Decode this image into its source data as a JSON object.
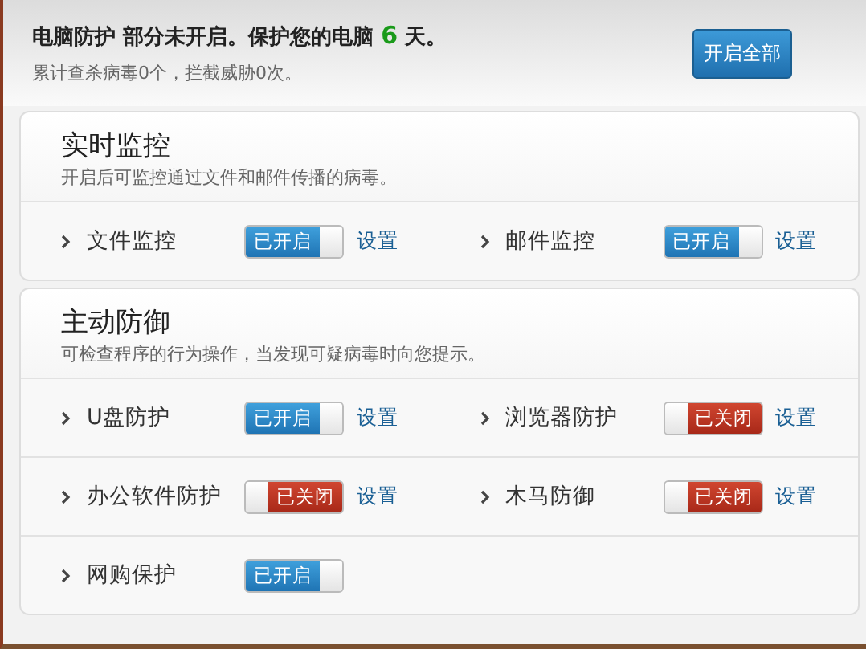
{
  "header": {
    "status_before": "电脑防护 部分未开启。保护您的电脑",
    "days": "6",
    "status_after": "天。",
    "stats": "累计查杀病毒0个，拦截威胁0次。",
    "button": "开启全部"
  },
  "sections": [
    {
      "title": "实时监控",
      "description": "开启后可监控通过文件和邮件传播的病毒。",
      "rows": [
        [
          {
            "label": "文件监控",
            "on": true,
            "toggle_text": "已开启",
            "settings": "设置"
          },
          {
            "label": "邮件监控",
            "on": true,
            "toggle_text": "已开启",
            "settings": "设置"
          }
        ]
      ]
    },
    {
      "title": "主动防御",
      "description": "可检查程序的行为操作，当发现可疑病毒时向您提示。",
      "rows": [
        [
          {
            "label": "U盘防护",
            "on": true,
            "toggle_text": "已开启",
            "settings": "设置"
          },
          {
            "label": "浏览器防护",
            "on": false,
            "toggle_text": "已关闭",
            "settings": "设置"
          }
        ],
        [
          {
            "label": "办公软件防护",
            "on": false,
            "toggle_text": "已关闭",
            "settings": "设置"
          },
          {
            "label": "木马防御",
            "on": false,
            "toggle_text": "已关闭",
            "settings": "设置"
          }
        ],
        [
          {
            "label": "网购保护",
            "on": true,
            "toggle_text": "已开启"
          }
        ]
      ]
    }
  ]
}
